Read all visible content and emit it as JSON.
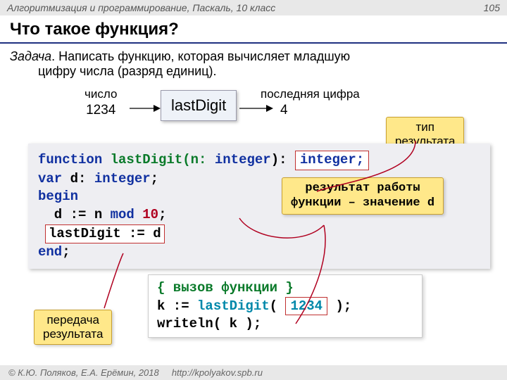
{
  "header": {
    "left": "Алгоритмизация и программирование, Паскаль, 10 класс",
    "page": "105"
  },
  "title": "Что такое функция?",
  "task": {
    "label": "Задача",
    "line1": ". Написать функцию, которая вычисляет младшую",
    "line2": "цифру числа (разряд единиц)."
  },
  "diagram": {
    "input_label": "число",
    "input_value": "1234",
    "fn_name": "lastDigit",
    "output_label": "последняя цифра",
    "output_value": "4"
  },
  "callouts": {
    "result_type": "тип\nрезультата",
    "result_work_l1": "результат работы",
    "result_work_l2a": "функции – значение ",
    "result_work_l2b": "d",
    "pass_result": "передача\nрезультата"
  },
  "code": {
    "l1_a": "function",
    "l1_b": " lastDigit(n: ",
    "l1_c": "integer",
    "l1_d": "):",
    "l1_hi": "integer;",
    "l2_a": "var",
    "l2_b": " d: ",
    "l2_c": "integer",
    "l2_d": ";",
    "l3": "begin",
    "l4_a": "  d := n ",
    "l4_b": "mod",
    "l4_c": " ",
    "l4_d": "10",
    "l4_e": ";",
    "l5_hi": "lastDigit := d",
    "l6": "end",
    "l6b": ";"
  },
  "call": {
    "comment": "{ вызов функции }",
    "l2_a": "k := ",
    "l2_b": "lastDigit",
    "l2_c": "( ",
    "l2_hi": "1234",
    "l2_d": " );",
    "l3": "writeln( k );"
  },
  "footer": {
    "left": "© К.Ю. Поляков, Е.А. Ерёмин, 2018",
    "url": "http://kpolyakov.spb.ru"
  }
}
